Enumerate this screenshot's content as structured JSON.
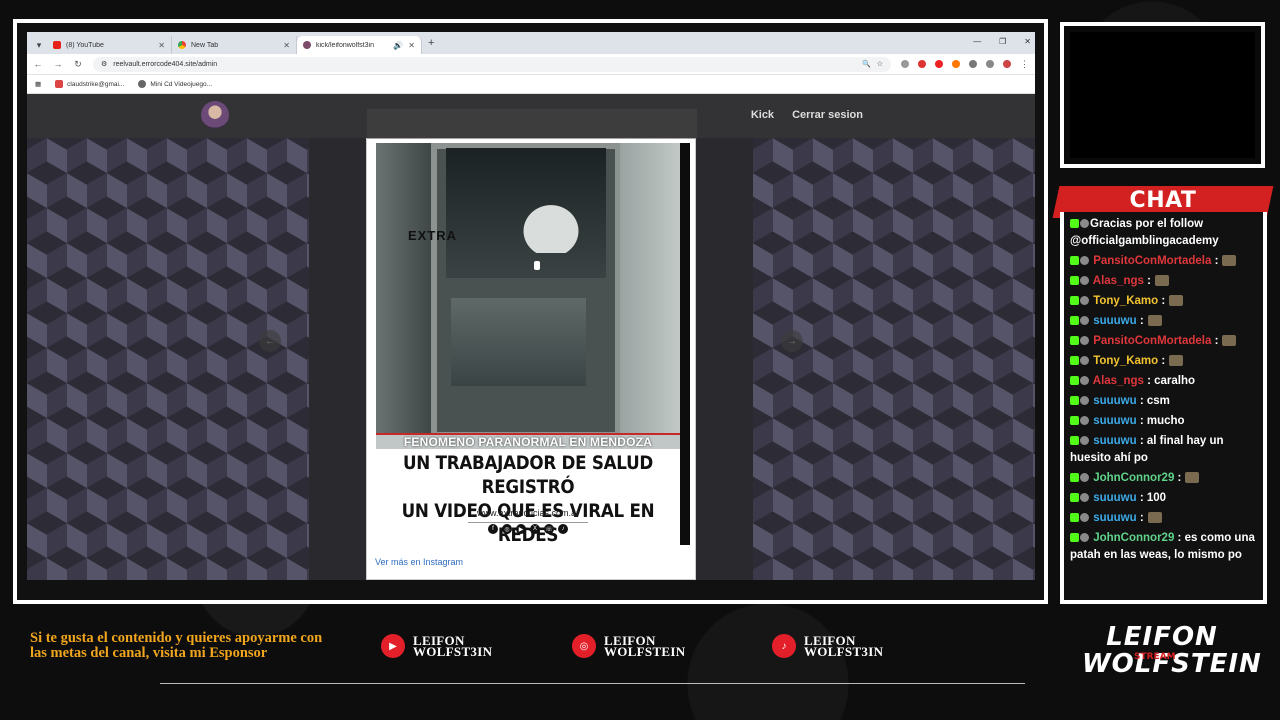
{
  "browser": {
    "tabs": [
      {
        "title": "(8) YouTube",
        "icon": "youtube-icon"
      },
      {
        "title": "New Tab",
        "icon": "chrome-icon"
      },
      {
        "title": "kick/leifonwolfst3in",
        "icon": "site-icon"
      }
    ],
    "url": "reelvault.errorcode404.site/admin",
    "bookmarks": [
      "claudstrike@gmai...",
      "Mini Cd Videojuego..."
    ]
  },
  "site": {
    "nav": [
      "Kick",
      "Cerrar sesion"
    ]
  },
  "post": {
    "watermark": "EXTRA",
    "caption": "FENOMENO PARANORMAL EN MENDOZA",
    "headline_line1": "UN TRABAJADOR DE SALUD REGISTRÓ",
    "headline_line2": "UN VIDEO QUE ES VIRAL EN REDES",
    "site_url": "www.extranoticias.com.ar",
    "instagram_link": "Ver más en Instagram"
  },
  "chat": {
    "title": "CHAT",
    "messages": [
      {
        "user": "",
        "text": "Gracias por el follow @officialgamblingacademy",
        "color": "#ffffff"
      },
      {
        "user": "PansitoConMortadela",
        "text": " :",
        "color": "#e0373c"
      },
      {
        "user": "Alas_ngs",
        "text": " :",
        "color": "#e0373c"
      },
      {
        "user": "Tony_Kamo",
        "text": " :",
        "color": "#f4c430"
      },
      {
        "user": "suuuwu",
        "text": " :",
        "color": "#3ca9e6"
      },
      {
        "user": "PansitoConMortadela",
        "text": " :",
        "color": "#e0373c"
      },
      {
        "user": "Tony_Kamo",
        "text": " :",
        "color": "#f4c430"
      },
      {
        "user": "Alas_ngs",
        "text": " : caralho",
        "color": "#e0373c"
      },
      {
        "user": "suuuwu",
        "text": " : csm",
        "color": "#3ca9e6"
      },
      {
        "user": "suuuwu",
        "text": " : mucho",
        "color": "#3ca9e6"
      },
      {
        "user": "suuuwu",
        "text": " : al final hay un huesito ahí po",
        "color": "#3ca9e6"
      },
      {
        "user": "JohnConnor29",
        "text": " :",
        "color": "#5fd38a"
      },
      {
        "user": "suuuwu",
        "text": " : 100",
        "color": "#3ca9e6"
      },
      {
        "user": "suuuwu",
        "text": " :",
        "color": "#3ca9e6"
      },
      {
        "user": "JohnConnor29",
        "text": " : es como una patah en las weas, lo mismo po",
        "color": "#5fd38a"
      }
    ]
  },
  "footer": {
    "sponsor_text": "Si te gusta el contenido y quieres apoyarme con las metas del canal, visita mi Esponsor",
    "socials": [
      {
        "platform": "youtube-icon",
        "line1": "LEIFON",
        "line2": "WOLFST3IN"
      },
      {
        "platform": "instagram-icon",
        "line1": "LEIFON",
        "line2": "WOLFSTEIN"
      },
      {
        "platform": "tiktok-icon",
        "line1": "LEIFON",
        "line2": "WOLFST3IN"
      }
    ],
    "brand_line1": "LEIFON",
    "brand_line2": "WOLFSTEIN",
    "brand_mid": "STREAM"
  }
}
